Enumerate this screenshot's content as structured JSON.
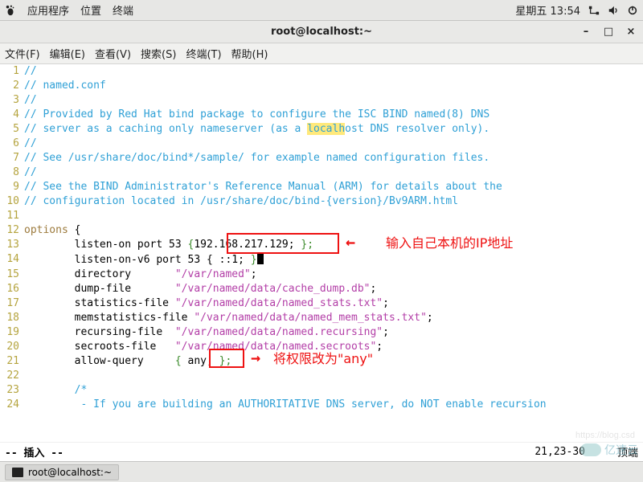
{
  "panel": {
    "app_menu": "应用程序",
    "places": "位置",
    "terminal": "终端",
    "clock": "星期五 13:54"
  },
  "window": {
    "title": "root@localhost:~"
  },
  "menubar": {
    "file": "文件(F)",
    "edit": "编辑(E)",
    "view": "查看(V)",
    "search": "搜索(S)",
    "terminal": "终端(T)",
    "help": "帮助(H)"
  },
  "code": {
    "l1": "//",
    "l2": "// named.conf",
    "l3": "//",
    "l4": "// Provided by Red Hat bind package to configure the ISC BIND named(8) DNS",
    "l5a": "// server as a caching only nameserver (as a ",
    "l5b": "localh",
    "l5c": "ost DNS resolver only).",
    "l6": "//",
    "l7": "// See /usr/share/doc/bind*/sample/ for example named configuration files.",
    "l8": "//",
    "l9": "// See the BIND Administrator's Reference Manual (ARM) for details about the",
    "l10": "// configuration located in /usr/share/doc/bind-{version}/Bv9ARM.html",
    "l11": "",
    "l12a": "options",
    "l12b": " {",
    "l13a": "        listen-on port 53 ",
    "l13b": "{",
    "l13c": "192.168.217.129;",
    "l13d": " };",
    "l14a": "        listen-on-v6 port 53 { ::1; ",
    "l14b": "}",
    "l15a": "        directory       ",
    "l15b": "\"/var/named\"",
    "l15c": ";",
    "l16a": "        dump-file       ",
    "l16b": "\"/var/named/data/cache_dump.db\"",
    "l16c": ";",
    "l17a": "        statistics-file ",
    "l17b": "\"/var/named/data/named_stats.txt\"",
    "l17c": ";",
    "l18a": "        memstatistics-file ",
    "l18b": "\"/var/named/data/named_mem_stats.txt\"",
    "l18c": ";",
    "l19a": "        recursing-file  ",
    "l19b": "\"/var/named/data/named.recursing\"",
    "l19c": ";",
    "l20a": "        secroots-file   ",
    "l20b": "\"/var/named/data/named.secroots\"",
    "l20c": ";",
    "l21a": "        allow-query     ",
    "l21b": "{ ",
    "l21c": "any;",
    "l21d": " };",
    "l22": "",
    "l23": "        /* ",
    "l24": "         - If you are building an AUTHORITATIVE DNS server, do NOT enable recursion"
  },
  "annotations": {
    "ip_note": "输入自己本机的IP地址",
    "any_note": "将权限改为\"any\""
  },
  "vim": {
    "mode": "-- 插入 --",
    "position": "21,23-30",
    "scroll": "顶端"
  },
  "taskbar": {
    "item1": "root@localhost:~"
  },
  "watermark": {
    "text": "亿速云",
    "faint": "https://blog.csd"
  }
}
